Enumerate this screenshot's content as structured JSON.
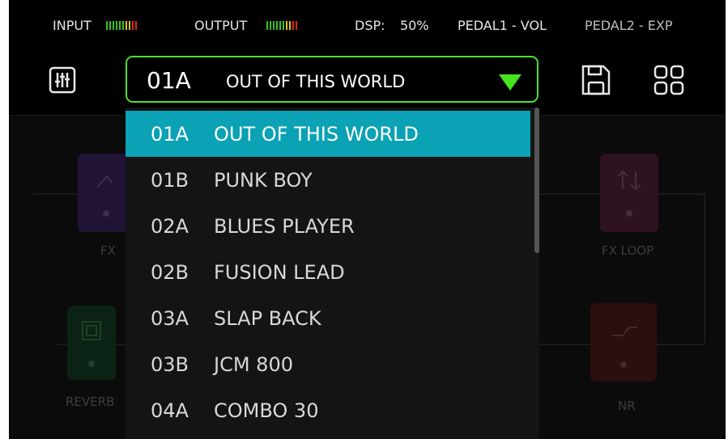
{
  "status": {
    "input_label": "INPUT",
    "output_label": "OUTPUT",
    "dsp_label": "DSP:",
    "dsp_value": "50%",
    "pedal1": "PEDAL1 - VOL",
    "pedal2": "PEDAL2 - EXP",
    "meter_colors": [
      "#37c21f",
      "#e0c21a",
      "#d9261f"
    ]
  },
  "toolbar": {
    "mixer_icon": "sliders-icon",
    "save_icon": "floppy-disk-icon",
    "grid_icon": "grid-icon"
  },
  "preset": {
    "number": "01A",
    "name": "OUT OF THIS WORLD",
    "accent": "#4ce22d"
  },
  "dropdown": {
    "selected_color": "#0aa2b4",
    "items": [
      {
        "num": "01A",
        "name": "OUT OF THIS WORLD"
      },
      {
        "num": "01B",
        "name": "PUNK BOY"
      },
      {
        "num": "02A",
        "name": "BLUES PLAYER"
      },
      {
        "num": "02B",
        "name": "FUSION LEAD"
      },
      {
        "num": "03A",
        "name": "SLAP BACK"
      },
      {
        "num": "03B",
        "name": "JCM 800"
      },
      {
        "num": "04A",
        "name": "COMBO 30"
      }
    ]
  },
  "diagram": {
    "blocks": [
      {
        "label": "FX"
      },
      {
        "label": "REVERB"
      },
      {
        "label": "FX LOOP"
      },
      {
        "label": "NR"
      }
    ]
  }
}
